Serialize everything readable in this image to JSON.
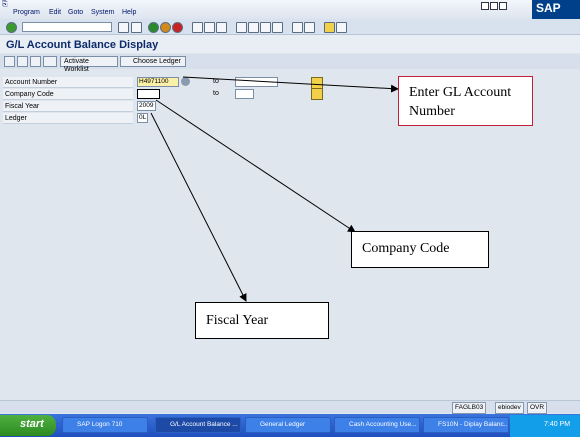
{
  "menu": [
    "Program",
    "Edit",
    "Goto",
    "System",
    "Help"
  ],
  "logo": "SAP",
  "page_title": "G/L Account Balance Display",
  "buttons": {
    "activate_worklist": "Activate Worklist",
    "choose_ledger": "Choose Ledger"
  },
  "form": {
    "account_label": "Account Number",
    "account_value": "H4971100",
    "company_label": "Company Code",
    "company_value": "",
    "fiscal_label": "Fiscal Year",
    "fiscal_value": "2009",
    "ledger_label": "Ledger",
    "ledger_value": "0L",
    "to_label": "to"
  },
  "callouts": {
    "gl": "Enter GL Account Number",
    "company": "Company Code",
    "fiscal": "Fiscal Year"
  },
  "status": {
    "transaction": "FAGLB03",
    "server": "ebiodev",
    "mode": "OVR"
  },
  "taskbar": {
    "start": "start",
    "items": [
      "SAP Logon 710",
      "G/L Account Balance ...",
      "General Ledger",
      "Cash Accounting Use...",
      "FS10N - Diplay Balanc..."
    ],
    "clock": "7:40 PM"
  }
}
